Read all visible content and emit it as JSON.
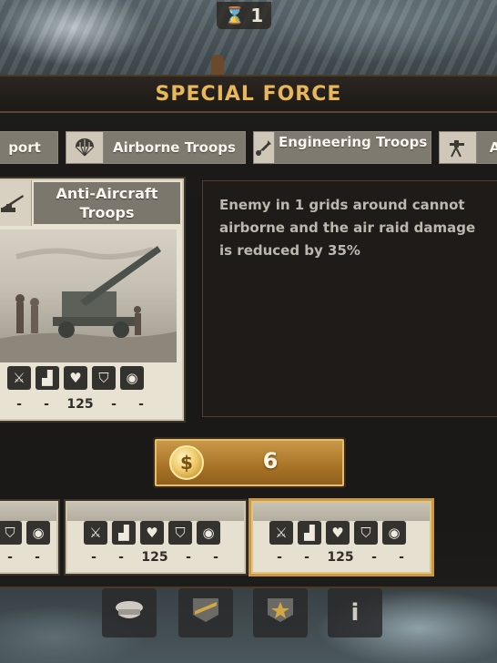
{
  "hud": {
    "counter": "1",
    "counter_icon": "hourglass-icon"
  },
  "panel": {
    "title": "SPECIAL FORCE"
  },
  "tabs": [
    {
      "label": "port",
      "icon": "supply-icon"
    },
    {
      "label": "Airborne Troops",
      "icon": "parachute-icon"
    },
    {
      "label": "Engineering Troops",
      "icon": "shovel-icon"
    },
    {
      "label": "A",
      "icon": "machine-gun-icon"
    }
  ],
  "selected_unit": {
    "name": "Anti-Aircraft Troops",
    "icon": "anti-aircraft-gun-icon",
    "stats": [
      "-",
      "-",
      "125",
      "-",
      "-"
    ],
    "stat_icons": [
      "attack-icon",
      "movement-icon",
      "health-icon",
      "defense-icon",
      "vision-icon"
    ]
  },
  "description": "Enemy in 1 grids around cannot airborne and the air raid damage is reduced by 35%",
  "purchase": {
    "price": "6",
    "currency_icon": "dollar-coin-icon",
    "currency_symbol": "$"
  },
  "bottom_cards": [
    {
      "stats": [
        "-",
        "-"
      ]
    },
    {
      "stats": [
        "-",
        "-",
        "125",
        "-",
        "-"
      ]
    },
    {
      "stats": [
        "-",
        "-",
        "125",
        "-",
        "-"
      ],
      "selected": true
    }
  ],
  "bottom_nav": [
    {
      "icon": "officer-cap-icon"
    },
    {
      "icon": "rank-stripes-icon"
    },
    {
      "icon": "star-rank-icon"
    },
    {
      "icon": "info-icon",
      "label": "i"
    }
  ],
  "colors": {
    "title": "#e7b75a",
    "price_button": "#b07b2b",
    "panel_bg": "#181614"
  }
}
